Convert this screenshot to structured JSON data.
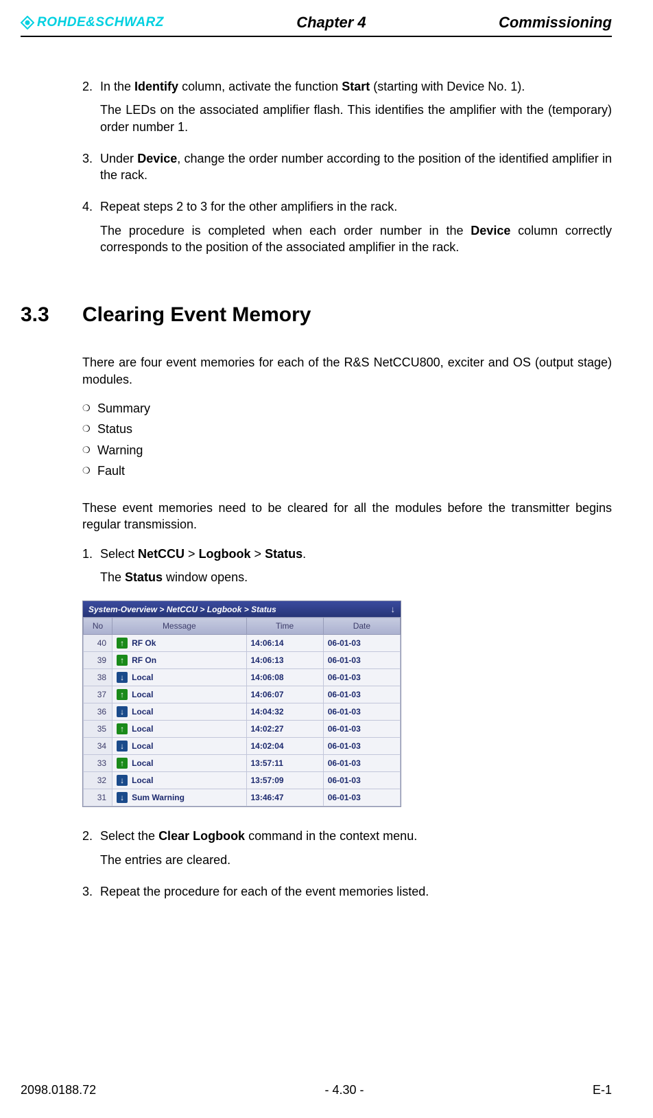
{
  "header": {
    "logo_text": "ROHDE&SCHWARZ",
    "chapter": "Chapter 4",
    "doc_title": "Commissioning"
  },
  "steps_top": {
    "s2_pre": "In the ",
    "s2_b1": "Identify",
    "s2_mid": " column, activate the function ",
    "s2_b2": "Start",
    "s2_post": " (starting with Device No. 1).",
    "s2_sub": "The LEDs on the associated amplifier flash. This identifies the amplifier with the (temporary) order number 1.",
    "s3_pre": "Under ",
    "s3_b1": "Device",
    "s3_post": ", change the order number according to the position of the identified amplifier in the rack.",
    "s4": "Repeat steps 2 to 3 for the other amplifiers in the rack.",
    "s4_sub_pre": "The procedure is completed when each order number in the ",
    "s4_sub_b": "Device",
    "s4_sub_post": " column correctly corresponds to the position of the associated amplifier in the rack."
  },
  "section": {
    "num": "3.3",
    "title": "Clearing Event Memory"
  },
  "body": {
    "intro": "There are four event memories for each of the R&S NetCCU800, exciter and OS (output stage) modules.",
    "bullets": [
      "Summary",
      "Status",
      "Warning",
      "Fault"
    ],
    "para2": "These event memories need to be cleared for all the modules before the transmitter begins regular transmission.",
    "step1_pre": "Select ",
    "step1_b1": "NetCCU",
    "step1_gt1": " > ",
    "step1_b2": "Logbook",
    "step1_gt2": " > ",
    "step1_b3": "Status",
    "step1_post": ".",
    "step1_sub_pre": "The ",
    "step1_sub_b": "Status",
    "step1_sub_post": " window opens.",
    "step2_pre": "Select the ",
    "step2_b": "Clear Logbook",
    "step2_post": " command in the context menu.",
    "step2_sub": "The entries are cleared.",
    "step3": "Repeat the procedure for each of the event memories listed."
  },
  "screenshot": {
    "breadcrumb": "System-Overview > NetCCU > Logbook > Status",
    "columns": {
      "no": "No",
      "msg": "Message",
      "time": "Time",
      "date": "Date"
    },
    "rows": [
      {
        "no": "40",
        "dir": "up",
        "msg": "RF Ok",
        "time": "14:06:14",
        "date": "06-01-03"
      },
      {
        "no": "39",
        "dir": "up",
        "msg": "RF On",
        "time": "14:06:13",
        "date": "06-01-03"
      },
      {
        "no": "38",
        "dir": "down",
        "msg": "Local",
        "time": "14:06:08",
        "date": "06-01-03"
      },
      {
        "no": "37",
        "dir": "up",
        "msg": "Local",
        "time": "14:06:07",
        "date": "06-01-03"
      },
      {
        "no": "36",
        "dir": "down",
        "msg": "Local",
        "time": "14:04:32",
        "date": "06-01-03"
      },
      {
        "no": "35",
        "dir": "up",
        "msg": "Local",
        "time": "14:02:27",
        "date": "06-01-03"
      },
      {
        "no": "34",
        "dir": "down",
        "msg": "Local",
        "time": "14:02:04",
        "date": "06-01-03"
      },
      {
        "no": "33",
        "dir": "up",
        "msg": "Local",
        "time": "13:57:11",
        "date": "06-01-03"
      },
      {
        "no": "32",
        "dir": "down",
        "msg": "Local",
        "time": "13:57:09",
        "date": "06-01-03"
      },
      {
        "no": "31",
        "dir": "down",
        "msg": "Sum Warning",
        "time": "13:46:47",
        "date": "06-01-03"
      }
    ]
  },
  "footer": {
    "left": "2098.0188.72",
    "center": "- 4.30 -",
    "right": "E-1"
  }
}
